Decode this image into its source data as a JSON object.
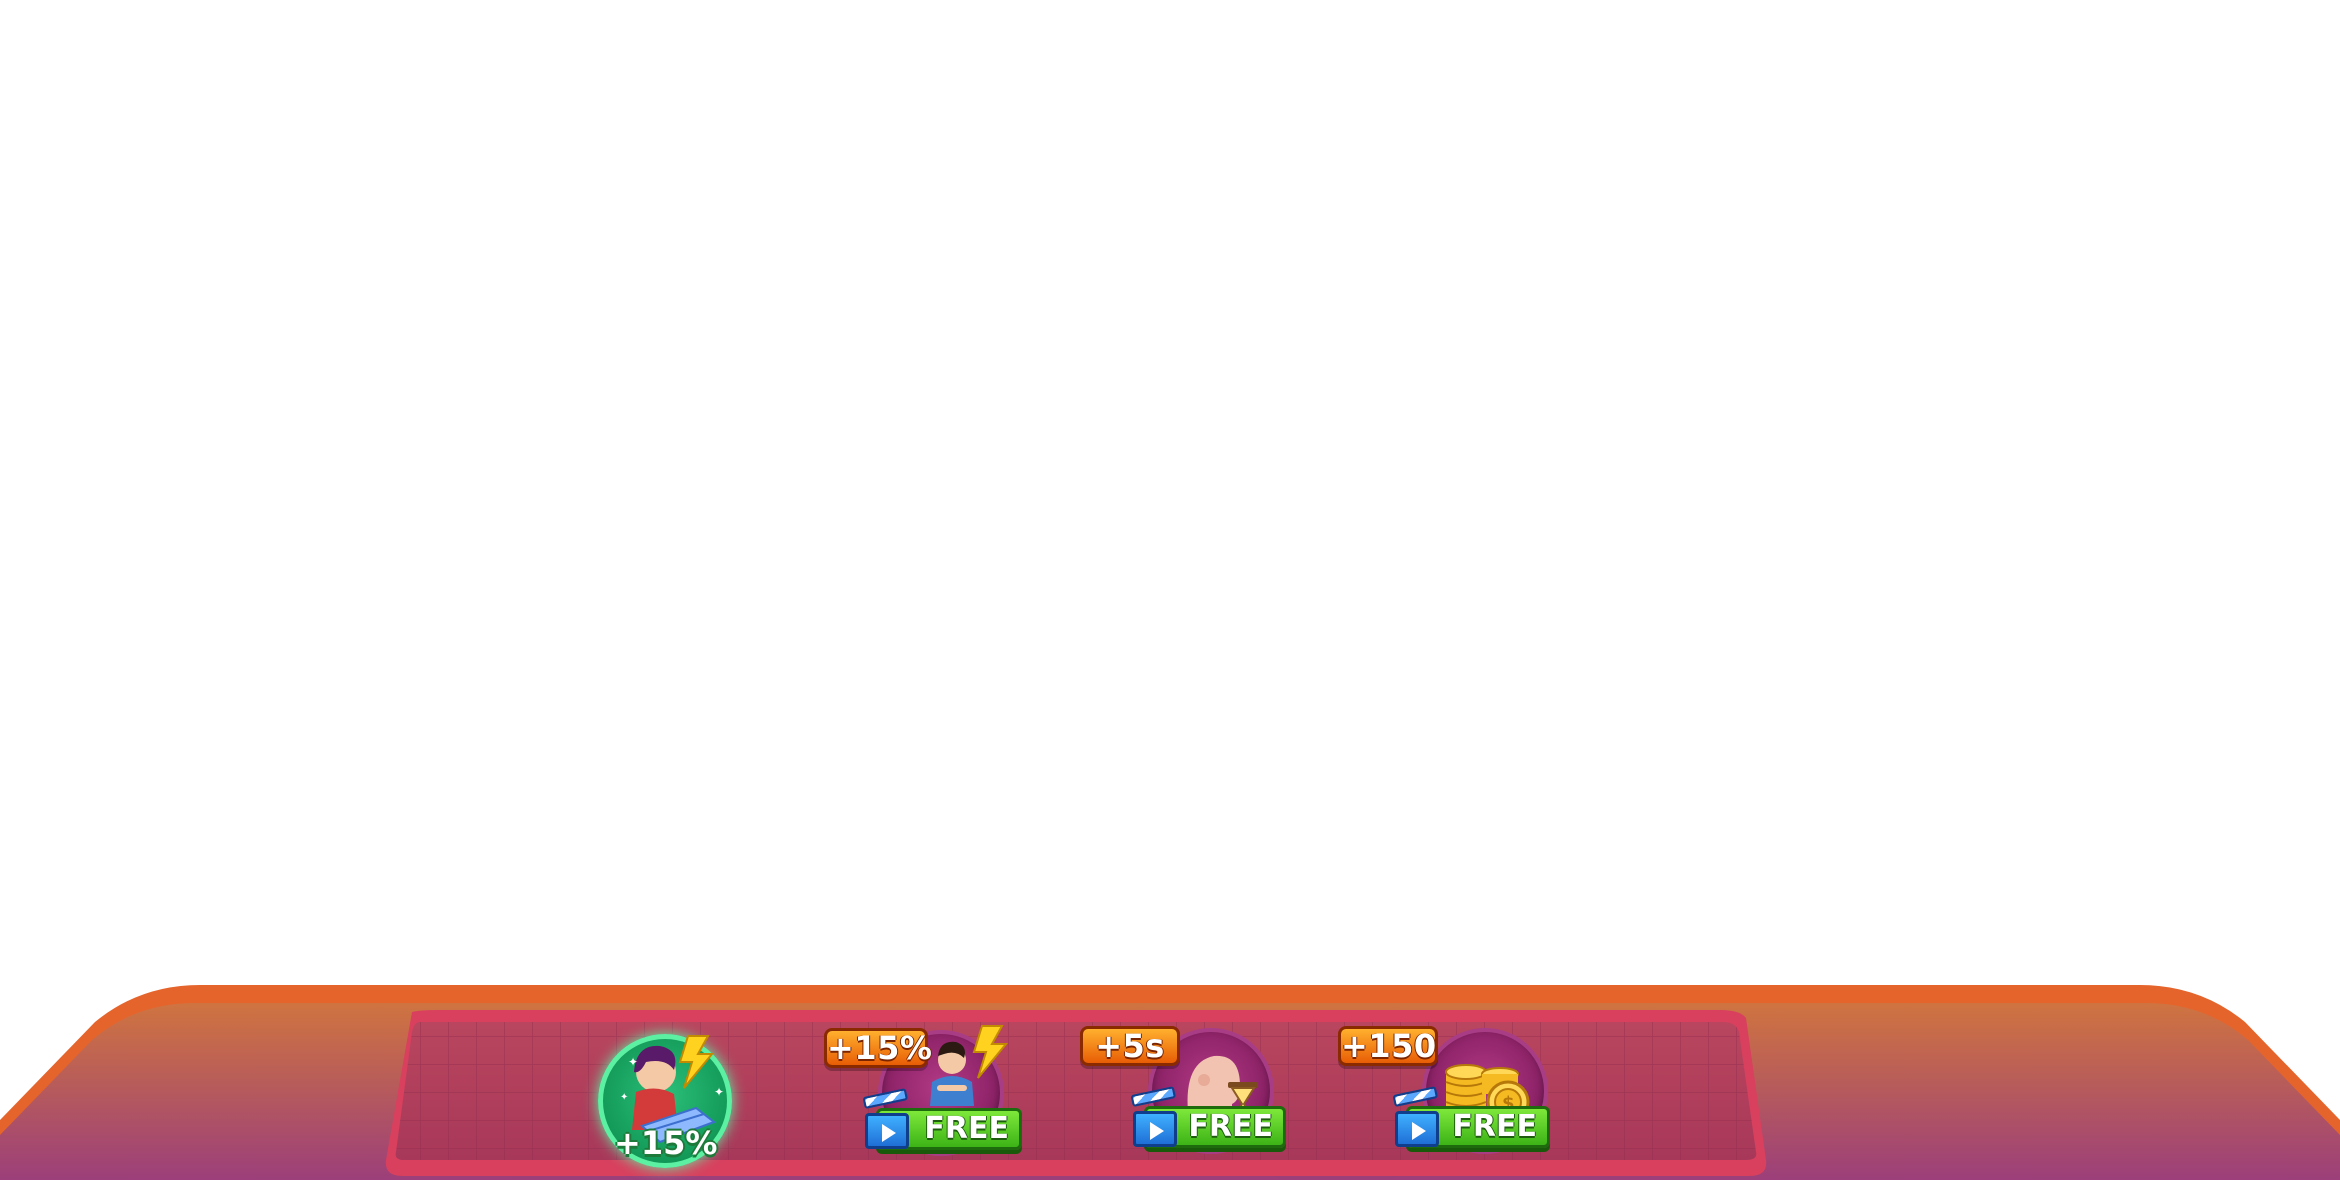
{
  "boosts": [
    {
      "id": "speed-active",
      "state": "active",
      "value_label": "+15%",
      "icon": "cashier-speed-lightning-icon"
    },
    {
      "id": "speed-video",
      "state": "offer",
      "badge_label": "+15%",
      "button_label": "FREE",
      "icon": "chef-speed-lightning-icon"
    },
    {
      "id": "patience-video",
      "state": "offer",
      "badge_label": "+5s",
      "button_label": "FREE",
      "icon": "customer-patience-hourglass-icon"
    },
    {
      "id": "coins-video",
      "state": "offer",
      "badge_label": "+150",
      "button_label": "FREE",
      "icon": "gold-coins-stack-icon"
    }
  ],
  "colors": {
    "frame_outer": "#e8612a",
    "frame_fill_top": "#c86a3e",
    "frame_fill_bottom": "#a0427a",
    "tray_border": "#e0486a",
    "badge": "#f08a1a",
    "free_button": "#5fd12a",
    "active_ring": "#2fd27a"
  }
}
